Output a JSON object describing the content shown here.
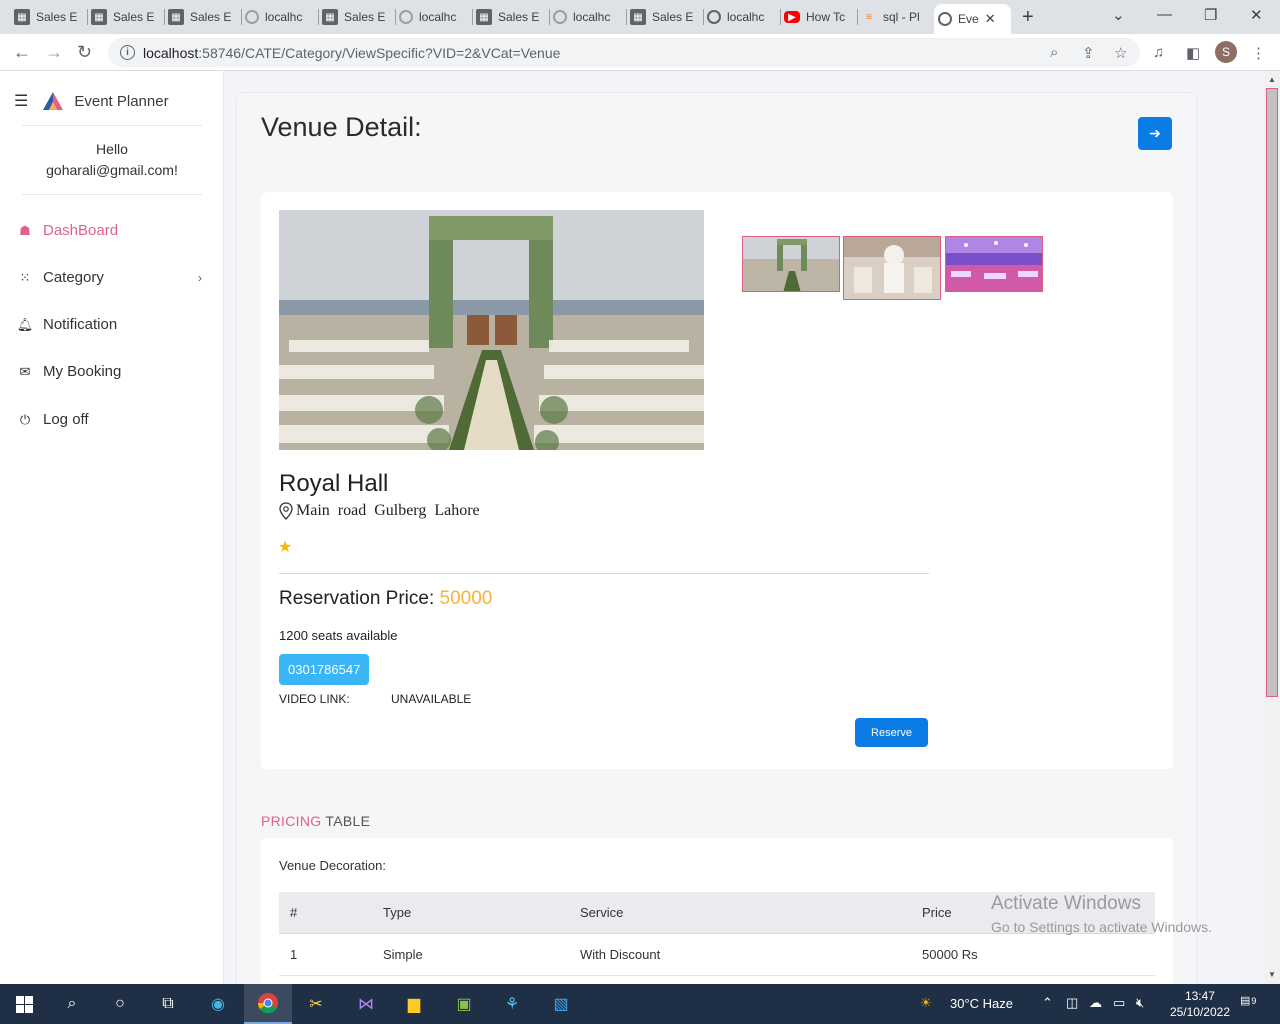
{
  "browser": {
    "tabs": [
      {
        "title": "Sales E",
        "favicon": "sales-favicon"
      },
      {
        "title": "Sales E",
        "favicon": "sales-favicon"
      },
      {
        "title": "Sales E",
        "favicon": "sales-favicon"
      },
      {
        "title": "localhc",
        "favicon": "loading-favicon"
      },
      {
        "title": "Sales E",
        "favicon": "sales-favicon"
      },
      {
        "title": "localhc",
        "favicon": "loading-favicon"
      },
      {
        "title": "Sales E",
        "favicon": "sales-favicon"
      },
      {
        "title": "localhc",
        "favicon": "loading-favicon"
      },
      {
        "title": "Sales E",
        "favicon": "sales-favicon"
      },
      {
        "title": "localhc",
        "favicon": "globe-favicon"
      },
      {
        "title": "How Tc",
        "favicon": "youtube-favicon"
      },
      {
        "title": "sql - Pl",
        "favicon": "stackoverflow-favicon"
      },
      {
        "title": "Eve",
        "favicon": "globe-favicon",
        "active": true
      }
    ],
    "url_host": "localhost",
    "url_path": ":58746/CATE/Category/ViewSpecific?VID=2&VCat=Venue",
    "profile_initial": "S"
  },
  "sidebar": {
    "app_name": "Event Planner",
    "greeting": "Hello",
    "user_email": "goharali@gmail.com!",
    "items": [
      {
        "label": "DashBoard",
        "icon": "home-icon",
        "active": true
      },
      {
        "label": "Category",
        "icon": "grid-icon",
        "has_submenu": true
      },
      {
        "label": "Notification",
        "icon": "bell-icon"
      },
      {
        "label": "My Booking",
        "icon": "booking-icon"
      },
      {
        "label": "Log off",
        "icon": "power-icon"
      }
    ]
  },
  "main": {
    "page_title": "Venue Detail:",
    "venue": {
      "name": "Royal Hall",
      "address": "Main road Gulberg Lahore",
      "rating_stars": 1,
      "price_label": "Reservation Price:",
      "price_value": "50000",
      "seats": "1200 seats available",
      "phone": "0301786547",
      "video_label": "VIDEO LINK:",
      "video_value": "UNAVAILABLE",
      "reserve_label": "Reserve"
    },
    "pricing": {
      "heading_highlight": "PRICING",
      "heading_rest": "TABLE",
      "section_label": "Venue Decoration:",
      "columns": [
        "#",
        "Type",
        "Service",
        "Price"
      ],
      "rows": [
        [
          "1",
          "Simple",
          "With Discount",
          "50000 Rs"
        ]
      ]
    },
    "colors": {
      "accent_blue": "#0b7ce5",
      "accent_pink": "#e4608a",
      "price_gold": "#f5b43c",
      "phone_blue": "#3ab5f5"
    }
  },
  "watermark": {
    "line1": "Activate Windows",
    "line2": "Go to Settings to activate Windows."
  },
  "taskbar": {
    "weather": "30°C  Haze",
    "time": "13:47",
    "date": "25/10/2022",
    "notification_count": "9"
  }
}
